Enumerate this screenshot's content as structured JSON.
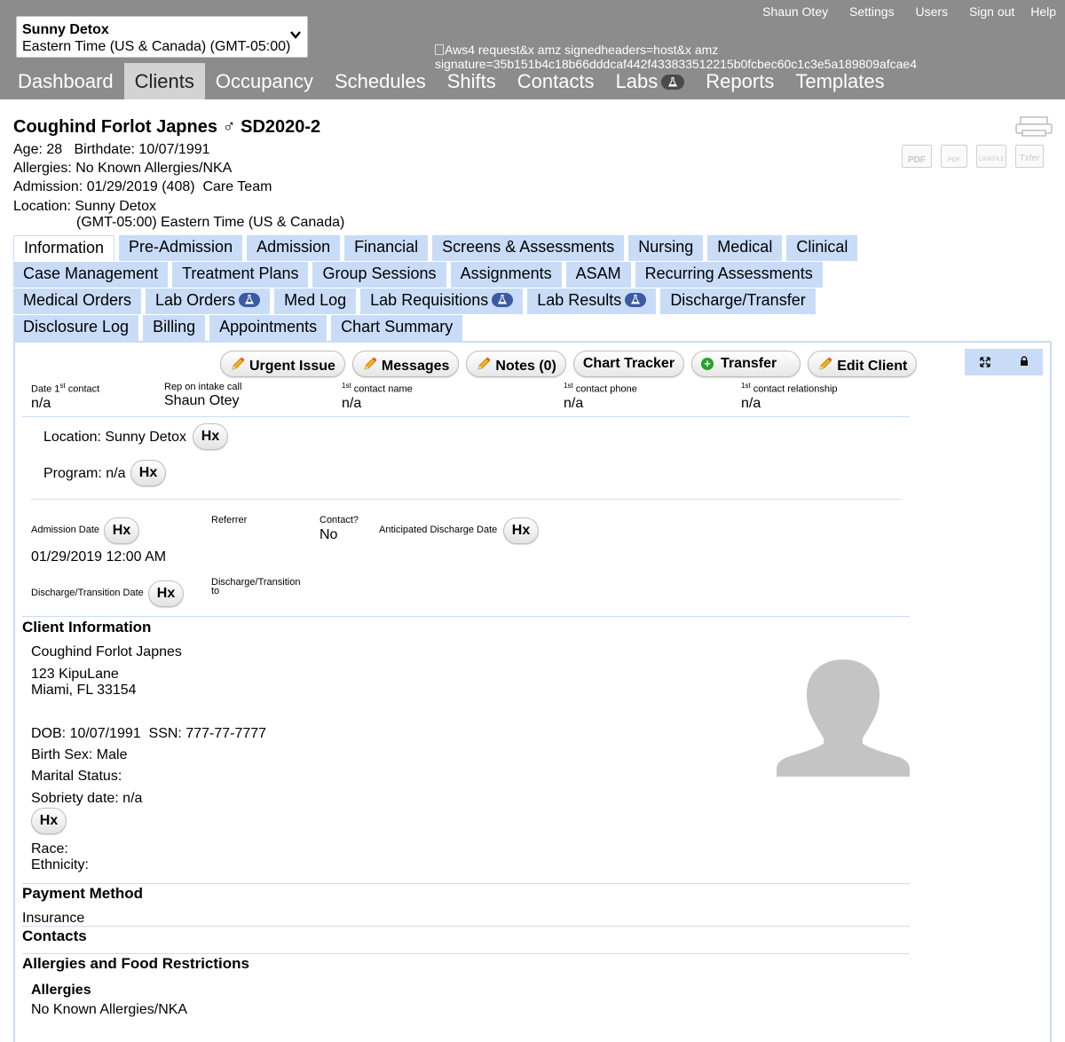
{
  "facility": {
    "name": "Sunny Detox",
    "timezone": "Eastern Time (US & Canada) (GMT-05:00)"
  },
  "top_links": [
    "Shaun Otey",
    "Settings",
    "Users",
    "Sign out",
    "Help"
  ],
  "broken_image_alt": "Aws4 request&x amz signedheaders=host&x amz signature=35b151b4c18b66dddcaf442f433833512215b0fcbec60c1c3e5a189809afcae4",
  "main_nav": [
    {
      "label": "Dashboard"
    },
    {
      "label": "Clients",
      "active": true
    },
    {
      "label": "Occupancy"
    },
    {
      "label": "Schedules"
    },
    {
      "label": "Shifts"
    },
    {
      "label": "Contacts"
    },
    {
      "label": "Labs",
      "icon": "flask-icon"
    },
    {
      "label": "Reports"
    },
    {
      "label": "Templates"
    }
  ],
  "client": {
    "name": "Coughind Forlot Japnes",
    "sex_symbol": "♂",
    "id": "SD2020-2",
    "age_label": "Age: 28",
    "birthdate_label": "Birthdate: 10/07/1991",
    "allergies_label": "Allergies: No Known Allergies/NKA",
    "admission_label": "Admission: 01/29/2019 (408)",
    "care_team_label": "Care Team",
    "location_label": "Location: Sunny Detox",
    "location_tz": "(GMT-05:00) Eastern Time (US & Canada)"
  },
  "doc_icons": [
    "PDF",
    "PDF",
    "CASEFILE",
    "Txfer"
  ],
  "tabs": {
    "row1": [
      "Information",
      "Pre-Admission",
      "Admission",
      "Financial",
      "Screens & Assessments",
      "Nursing",
      "Medical",
      "Clinical"
    ],
    "row2": [
      "Case Management",
      "Treatment Plans",
      "Group Sessions",
      "Assignments",
      "ASAM",
      "Recurring Assessments"
    ],
    "row3": [
      "Medical Orders",
      "Lab Orders",
      "Med Log",
      "Lab Requisitions",
      "Lab Results",
      "Discharge/Transfer"
    ],
    "row4": [
      "Disclosure Log",
      "Billing",
      "Appointments",
      "Chart Summary"
    ]
  },
  "actions": [
    "Urgent Issue",
    "Messages",
    "Notes (0)",
    "Chart Tracker",
    "Transfer",
    "Edit Client"
  ],
  "first_contact": {
    "date_label_a": "Date 1",
    "date_label_sup": "st",
    "date_label_b": " contact",
    "date_value": "n/a",
    "rep_label": "Rep on intake call",
    "rep_value": "Shaun Otey",
    "name_label_sup": "1st",
    "name_label": " contact name",
    "name_value": "n/a",
    "phone_label_sup": "1st",
    "phone_label": " contact phone",
    "phone_value": "n/a",
    "rel_label_sup": "1st",
    "rel_label": " contact relationship",
    "rel_value": "n/a"
  },
  "hx_label": "Hx",
  "location_line": "Location: Sunny Detox",
  "program_line": "Program: n/a",
  "admission": {
    "admission_date_label": "Admission Date",
    "admission_date_value": "01/29/2019 12:00 AM",
    "referrer_label": "Referrer",
    "contact_label": "Contact?",
    "contact_value": "No",
    "anticipated_label": "Anticipated Discharge Date",
    "discharge_date_label": "Discharge/Transition Date",
    "discharge_to_label_1": "Discharge/Transition",
    "discharge_to_label_2": "to"
  },
  "client_info": {
    "heading": "Client Information",
    "name": "Coughind Forlot Japnes",
    "address1": "123 KipuLane",
    "address2": "Miami, FL 33154",
    "dob_ssn": "DOB: 10/07/1991  SSN: 777-77-7777",
    "birth_sex": "Birth Sex: Male",
    "marital": "Marital Status:",
    "sobriety": "Sobriety date: n/a",
    "race": "Race:",
    "ethnicity": "Ethnicity:"
  },
  "payment": {
    "heading": "Payment Method",
    "value": "Insurance"
  },
  "contacts_heading": "Contacts",
  "allergies_section": {
    "heading": "Allergies and Food Restrictions",
    "subheading": "Allergies",
    "value": "No Known Allergies/NKA"
  }
}
